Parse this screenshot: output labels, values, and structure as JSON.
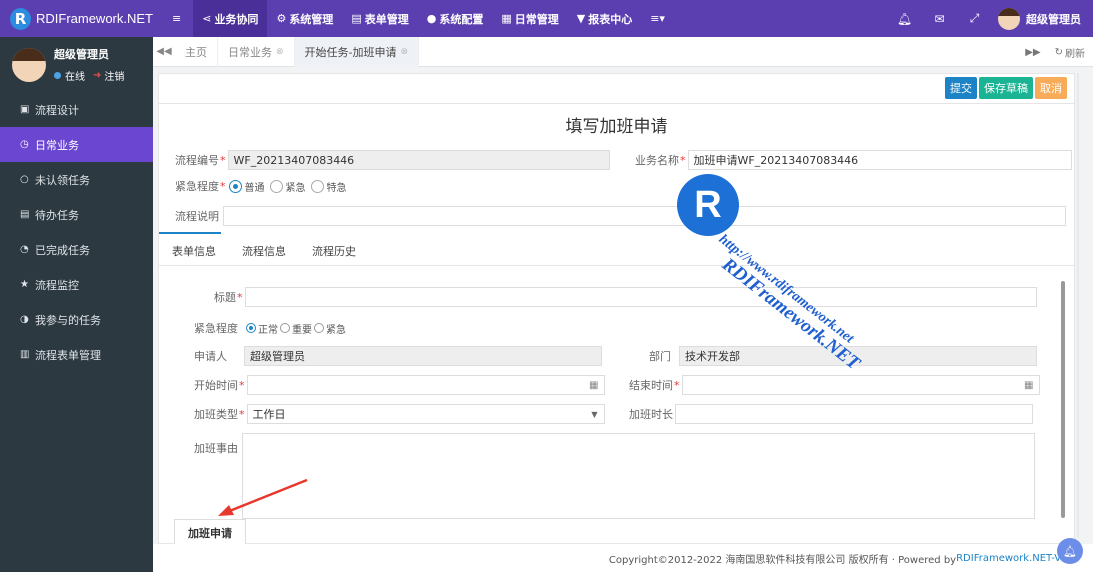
{
  "app": {
    "brand": "RDIFramework.NET",
    "logo_letter": "R"
  },
  "topnav": {
    "items": [
      {
        "icon": "≡",
        "label": ""
      },
      {
        "icon": "⋖",
        "label": "业务协同"
      },
      {
        "icon": "⚙",
        "label": "系统管理"
      },
      {
        "icon": "▤",
        "label": "表单管理"
      },
      {
        "icon": "●",
        "label": "系统配置"
      },
      {
        "icon": "▦",
        "label": "日常管理"
      },
      {
        "icon": "▼",
        "label": "报表中心"
      },
      {
        "icon": "≡▾",
        "label": ""
      }
    ],
    "user_name": "超级管理员"
  },
  "sidebar": {
    "user_name": "超级管理员",
    "status_online": "在线",
    "status_logout": "注销",
    "items": [
      {
        "icon": "▣",
        "label": "流程设计"
      },
      {
        "icon": "◷",
        "label": "日常业务"
      },
      {
        "icon": "○",
        "label": "未认领任务"
      },
      {
        "icon": "▤",
        "label": "待办任务"
      },
      {
        "icon": "◔",
        "label": "已完成任务"
      },
      {
        "icon": "★",
        "label": "流程监控"
      },
      {
        "icon": "◑",
        "label": "我参与的任务"
      },
      {
        "icon": "▥",
        "label": "流程表单管理"
      }
    ]
  },
  "tabs": {
    "items": [
      {
        "label": "主页"
      },
      {
        "label": "日常业务"
      },
      {
        "label": "开始任务-加班申请"
      }
    ],
    "refresh_label": "刷新"
  },
  "toolbar": {
    "submit": "提交",
    "save_draft": "保存草稿",
    "cancel": "取消"
  },
  "form": {
    "title": "填写加班申请",
    "flow_no_label": "流程编号",
    "flow_no_value": "WF_20213407083446",
    "biz_name_label": "业务名称",
    "biz_name_value": "加班申请WF_20213407083446",
    "urgency_label": "紧急程度",
    "urgency_options": [
      "普通",
      "紧急",
      "特急"
    ],
    "urgency_selected": "普通",
    "desc_label": "流程说明",
    "desc_value": ""
  },
  "subtabs": [
    "表单信息",
    "流程信息",
    "流程历史"
  ],
  "overtime": {
    "title_label": "标题",
    "title_value": "",
    "urgency_label": "紧急程度",
    "urgency_options": [
      "正常",
      "重要",
      "紧急"
    ],
    "urgency_selected": "正常",
    "applicant_label": "申请人",
    "applicant_value": "超级管理员",
    "dept_label": "部门",
    "dept_value": "技术开发部",
    "start_label": "开始时间",
    "start_value": "",
    "end_label": "结束时间",
    "end_value": "",
    "type_label": "加班类型",
    "type_value": "工作日",
    "duration_label": "加班时长",
    "duration_value": "",
    "reason_label": "加班事由",
    "reason_value": ""
  },
  "bottom_tab": "加班申请",
  "footer": {
    "copyright": "Copyright©2012-2022 海南国思软件科技有限公司 版权所有 · Powered by ",
    "link": "RDIFramework.NET-V5.1"
  },
  "watermark": {
    "logo": "R",
    "brand": "RDIFramework.NET",
    "url": "http://www.rdiframework.net"
  },
  "colors": {
    "topbar": "#5b3fb1",
    "sidebar": "#2c3940",
    "sidebar_active": "#6a46d1",
    "primary": "#1c84c6",
    "success": "#1ab394",
    "warning": "#f8ac59",
    "arrow": "#e8382e"
  }
}
